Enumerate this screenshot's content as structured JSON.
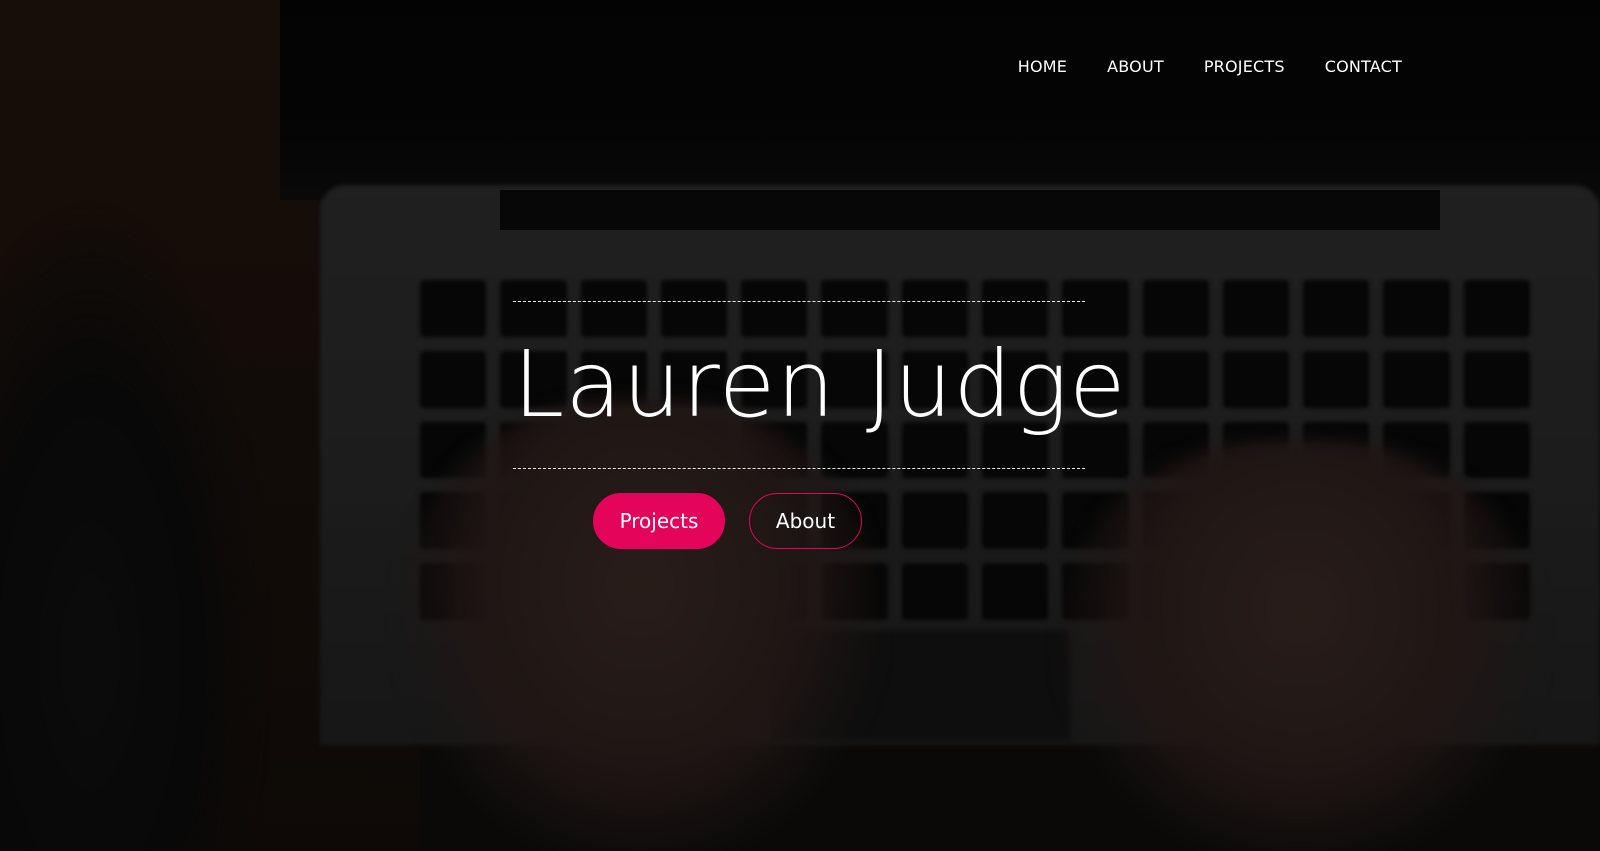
{
  "nav": {
    "items": [
      {
        "label": "HOME"
      },
      {
        "label": "ABOUT"
      },
      {
        "label": "PROJECTS"
      },
      {
        "label": "CONTACT"
      }
    ]
  },
  "hero": {
    "title": "Lauren Judge",
    "buttons": {
      "primary_label": "Projects",
      "secondary_label": "About"
    }
  },
  "colors": {
    "accent": "#e4045a",
    "text": "#ffffff",
    "overlay": "rgba(0,0,0,0.45)"
  },
  "background": {
    "icon": "laptop-typing-photo"
  }
}
